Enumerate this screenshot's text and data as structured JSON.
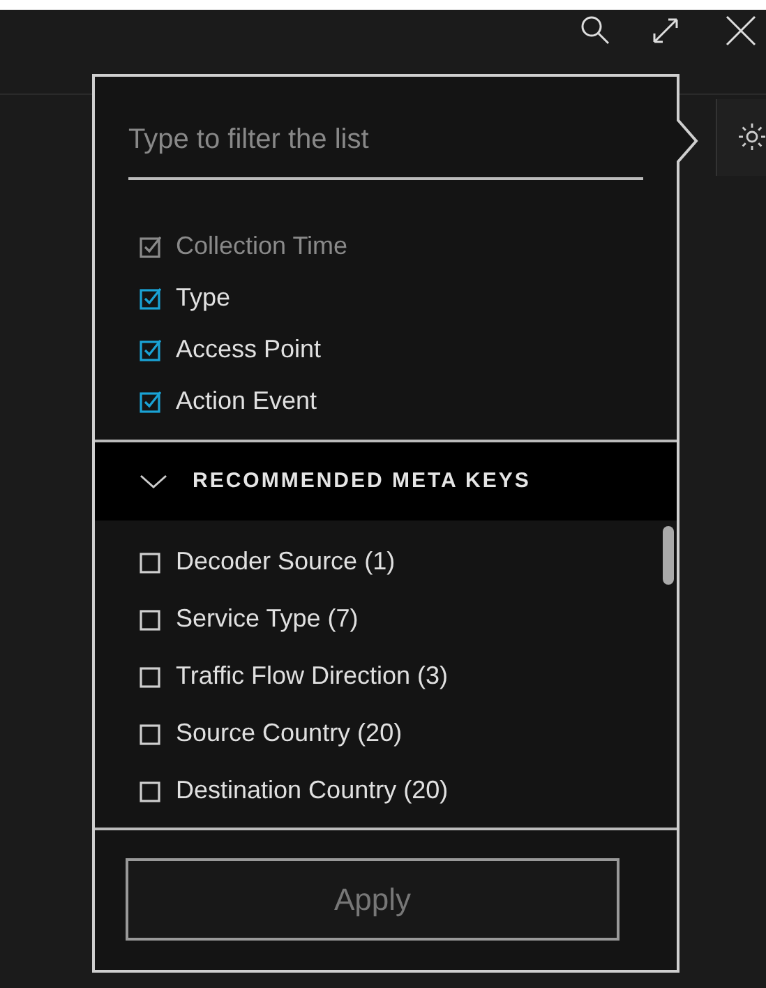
{
  "filter": {
    "placeholder": "Type to filter the list"
  },
  "selected_keys": [
    {
      "label": "Collection Time",
      "checked": true,
      "disabled": true
    },
    {
      "label": "Type",
      "checked": true,
      "disabled": false
    },
    {
      "label": "Access Point",
      "checked": true,
      "disabled": false
    },
    {
      "label": "Action Event",
      "checked": true,
      "disabled": false
    }
  ],
  "recommended_section": {
    "title": "RECOMMENDED META KEYS",
    "expanded": true,
    "items": [
      {
        "label": "Decoder Source (1)",
        "checked": false
      },
      {
        "label": "Service Type (7)",
        "checked": false
      },
      {
        "label": "Traffic Flow Direction (3)",
        "checked": false
      },
      {
        "label": "Source Country (20)",
        "checked": false
      },
      {
        "label": "Destination Country (20)",
        "checked": false
      }
    ]
  },
  "apply_button": {
    "label": "Apply",
    "disabled": true
  }
}
